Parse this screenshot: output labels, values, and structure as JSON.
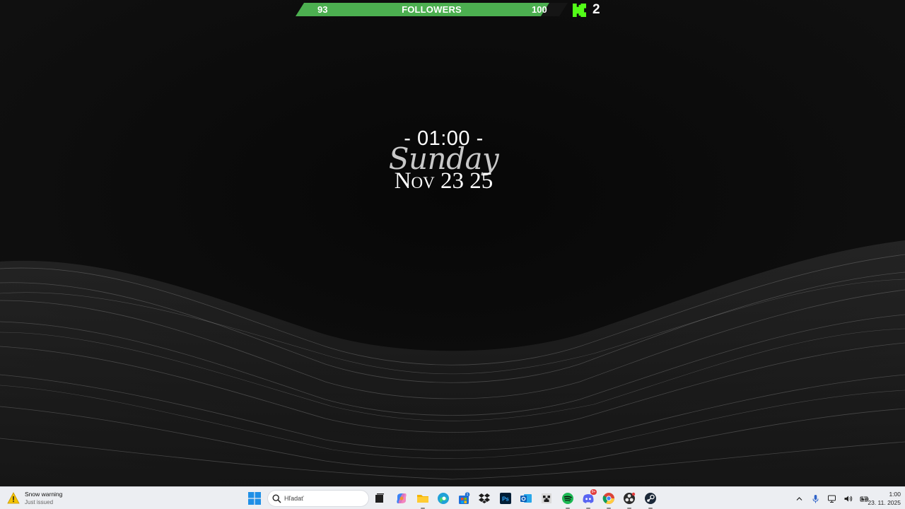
{
  "followers_goal": {
    "current": "93",
    "label": "FOLLOWERS",
    "goal": "100",
    "progress": 0.93,
    "bar_color": "#4caf50"
  },
  "kick": {
    "icon": "kick-logo-icon",
    "count": "2",
    "color": "#53fc18"
  },
  "clock_widget": {
    "time": "- 01:00 -",
    "day": "Sunday",
    "date": "Nov 23 25"
  },
  "taskbar": {
    "weather": {
      "icon": "snow-warning-icon",
      "title": "Snow warning",
      "subtitle": "Just issued"
    },
    "search_placeholder": "Hľadať",
    "apps": [
      {
        "name": "start-button",
        "icon": "windows-logo-icon"
      },
      {
        "name": "task-view",
        "icon": "task-view-icon"
      },
      {
        "name": "copilot",
        "icon": "copilot-icon"
      },
      {
        "name": "file-explorer",
        "icon": "folder-icon"
      },
      {
        "name": "edge",
        "icon": "edge-icon"
      },
      {
        "name": "microsoft-store",
        "icon": "store-icon",
        "badge": "1"
      },
      {
        "name": "dropbox",
        "icon": "dropbox-icon"
      },
      {
        "name": "photoshop",
        "icon": "photoshop-icon"
      },
      {
        "name": "outlook",
        "icon": "outlook-icon"
      },
      {
        "name": "minecraft",
        "icon": "minecraft-icon"
      },
      {
        "name": "spotify",
        "icon": "spotify-icon"
      },
      {
        "name": "discord",
        "icon": "discord-icon",
        "badge": "9+"
      },
      {
        "name": "chrome",
        "icon": "chrome-icon"
      },
      {
        "name": "obs-studio",
        "icon": "obs-icon"
      },
      {
        "name": "steam",
        "icon": "steam-icon"
      }
    ],
    "tray": {
      "icons": [
        "chevron-up-icon",
        "microphone-icon",
        "network-icon",
        "volume-icon",
        "battery-icon"
      ],
      "time": "1:00",
      "date": "23. 11. 2025"
    }
  }
}
